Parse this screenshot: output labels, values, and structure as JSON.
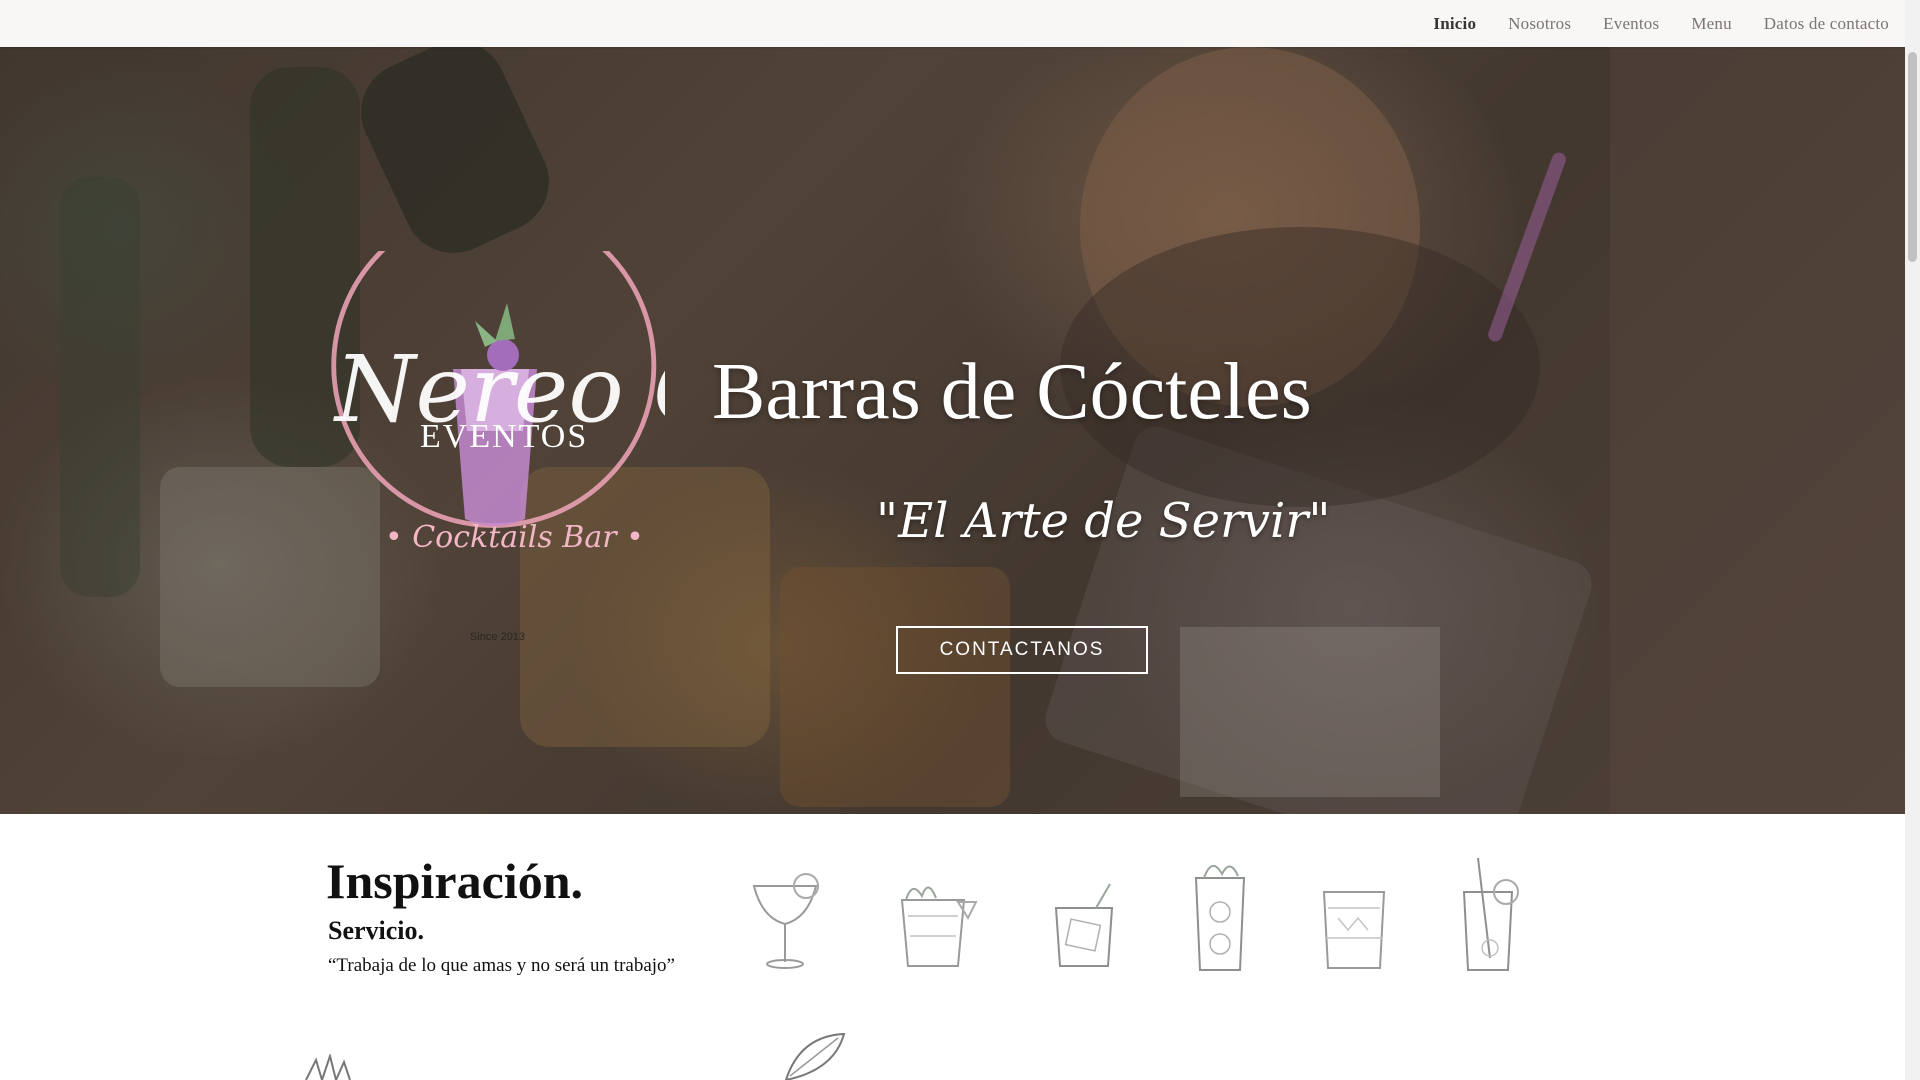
{
  "nav": {
    "items": [
      {
        "label": "Inicio",
        "active": true
      },
      {
        "label": "Nosotros",
        "active": false
      },
      {
        "label": "Eventos",
        "active": false
      },
      {
        "label": "Menu",
        "active": false
      },
      {
        "label": "Datos de contacto",
        "active": false
      }
    ]
  },
  "hero": {
    "title": "Barras de Cócteles",
    "subtitle": "\"El Arte de Servir\"",
    "cta_label": "CONTACTANOS",
    "logo": {
      "script_text": "Nereo C",
      "word": "EVENTOS",
      "tagline": "• Cocktails Bar •",
      "since": "Since 2013"
    }
  },
  "section": {
    "headline": "Inspiración.",
    "subhead": "Servicio.",
    "quote": "“Trabaja de lo que amas y no será un trabajo”",
    "drink_icons": [
      "margarita-glass-icon",
      "mojito-glass-icon",
      "old-fashioned-glass-icon",
      "tall-mojito-icon",
      "rocks-glass-icon",
      "highball-straw-icon"
    ]
  },
  "colors": {
    "nav_bg": "#f8f7f5",
    "nav_active": "#3a3431",
    "nav_text": "#7d7470",
    "logo_ring": "#e8a0b4",
    "logo_drink": "#c38ad0"
  }
}
